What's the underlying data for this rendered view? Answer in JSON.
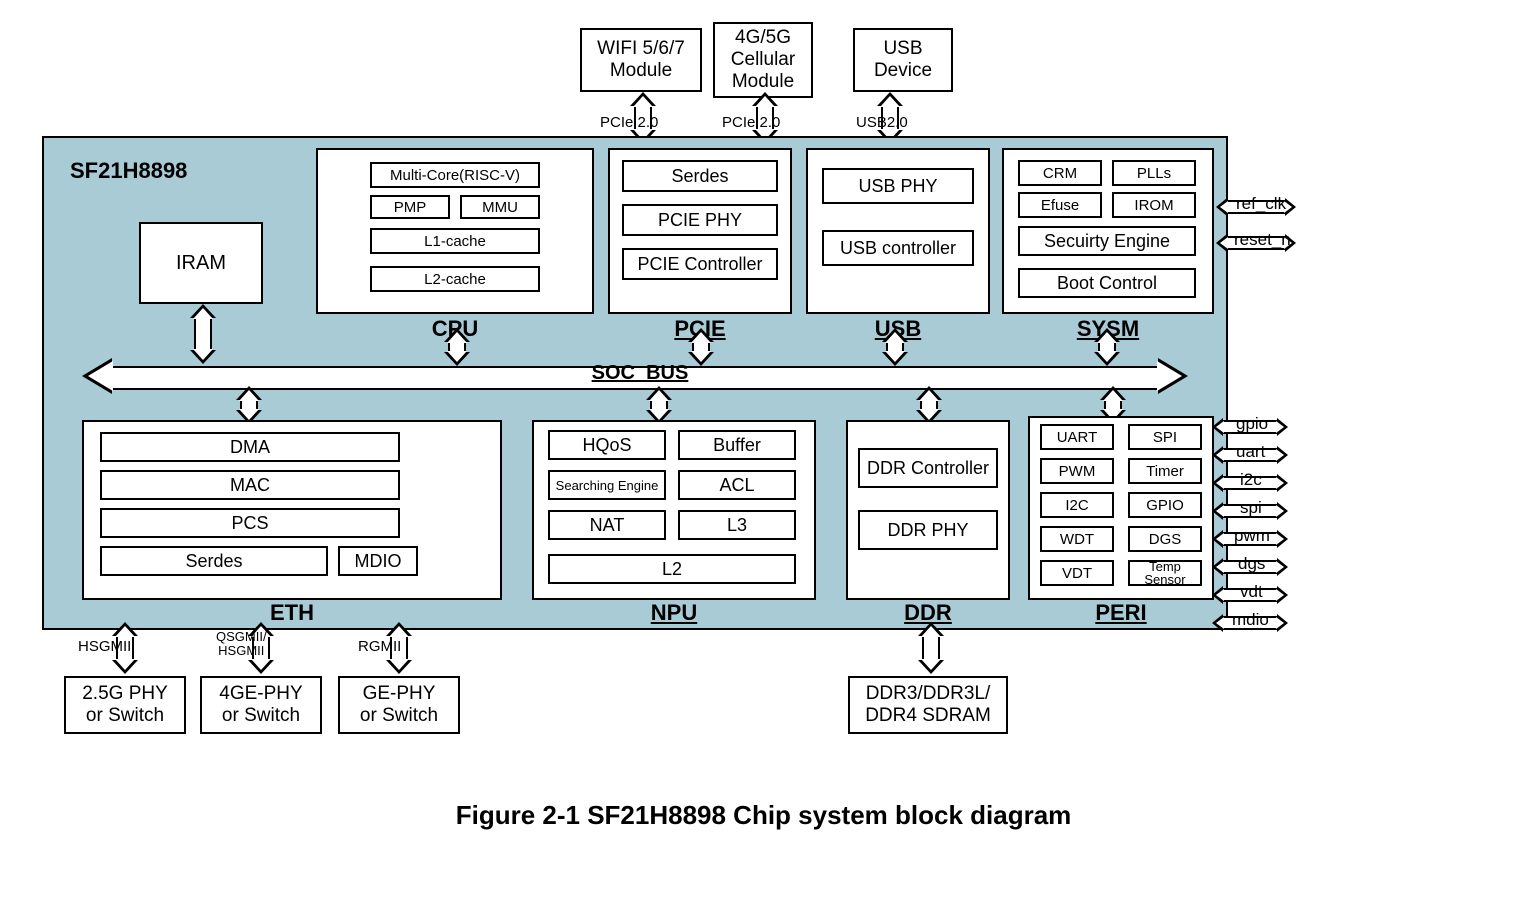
{
  "caption": "Figure 2-1 SF21H8898 Chip system block diagram",
  "chip_name": "SF21H8898",
  "bus_label": "SOC_BUS",
  "ext_top": {
    "wifi": "WIFI 5/6/7\nModule",
    "cell": "4G/5G\nCellular\nModule",
    "usbdev": "USB\nDevice"
  },
  "ext_top_if": {
    "pcie1": "PCIe 2.0",
    "pcie2": "PCIe 2.0",
    "usb": "USB2.0"
  },
  "iram": "IRAM",
  "cpu": {
    "title": "CPU",
    "core": "Multi-Core(RISC-V)",
    "pmp": "PMP",
    "mmu": "MMU",
    "l1": "L1-cache",
    "l2": "L2-cache"
  },
  "pcie": {
    "title": "PCIE",
    "serdes": "Serdes",
    "phy": "PCIE PHY",
    "ctrl": "PCIE Controller"
  },
  "usb": {
    "title": "USB",
    "phy": "USB PHY",
    "ctrl": "USB controller"
  },
  "sysm": {
    "title": "SYSM",
    "crm": "CRM",
    "plls": "PLLs",
    "efuse": "Efuse",
    "irom": "IROM",
    "sec": "Secuirty Engine",
    "boot": "Boot Control"
  },
  "eth": {
    "title": "ETH",
    "dma": "DMA",
    "mac": "MAC",
    "pcs": "PCS",
    "serdes": "Serdes",
    "mdio": "MDIO"
  },
  "npu": {
    "title": "NPU",
    "hqos": "HQoS",
    "buffer": "Buffer",
    "se": "Searching Engine",
    "acl": "ACL",
    "nat": "NAT",
    "l3": "L3",
    "l2": "L2"
  },
  "ddr": {
    "title": "DDR",
    "ctrl": "DDR Controller",
    "phy": "DDR PHY"
  },
  "peri": {
    "title": "PERI",
    "uart": "UART",
    "spi": "SPI",
    "pwm": "PWM",
    "timer": "Timer",
    "i2c": "I2C",
    "gpio": "GPIO",
    "wdt": "WDT",
    "dgs": "DGS",
    "vdt": "VDT",
    "ts": "Temp\nSensor"
  },
  "ext_bot": {
    "phy25": "2.5G PHY\nor Switch",
    "phy4ge": "4GE-PHY\nor Switch",
    "phyge": "GE-PHY\nor Switch",
    "sdram": "DDR3/DDR3L/\nDDR4 SDRAM"
  },
  "eth_if": {
    "hsgmii": "HSGMII",
    "qsgmii": "QSGMII/\nHSGMII",
    "rgmii": "RGMII"
  },
  "right_sig_top": {
    "refclk": "ref_clk",
    "resetn": "reset_n"
  },
  "right_sig_bot": {
    "gpio": "gpio",
    "uart": "uart",
    "i2c": "i2c",
    "spi": "spi",
    "pwm": "pwm",
    "dgs": "dgs",
    "vdt": "vdt",
    "mdio": "mdio"
  }
}
